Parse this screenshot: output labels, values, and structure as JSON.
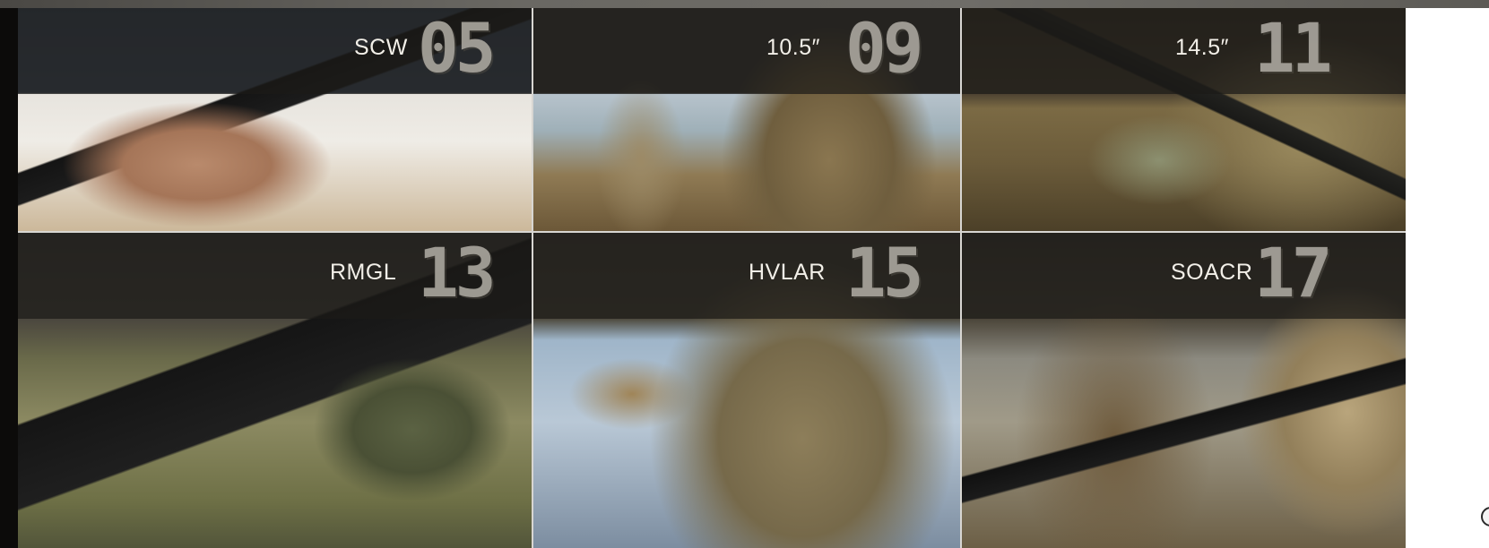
{
  "tiles": [
    {
      "label": "SCW",
      "number": "05",
      "image": "hand-gripping-rifle-photo"
    },
    {
      "label": "10.5″",
      "number": "09",
      "image": "soldiers-in-field-photo"
    },
    {
      "label": "14.5″",
      "number": "11",
      "image": "camo-soldier-rifle-photo"
    },
    {
      "label": "RMGL",
      "number": "13",
      "image": "grenade-launcher-photo"
    },
    {
      "label": "HVLAR",
      "number": "15",
      "image": "soldier-with-carbine-photo"
    },
    {
      "label": "SOACR",
      "number": "17",
      "image": "sniper-suppressed-rifle-photo"
    }
  ],
  "colors": {
    "band": "#1c1a18",
    "label_text": "#f2efe8",
    "number_text": "#a8a49c",
    "divider": "#d8d6d2"
  }
}
